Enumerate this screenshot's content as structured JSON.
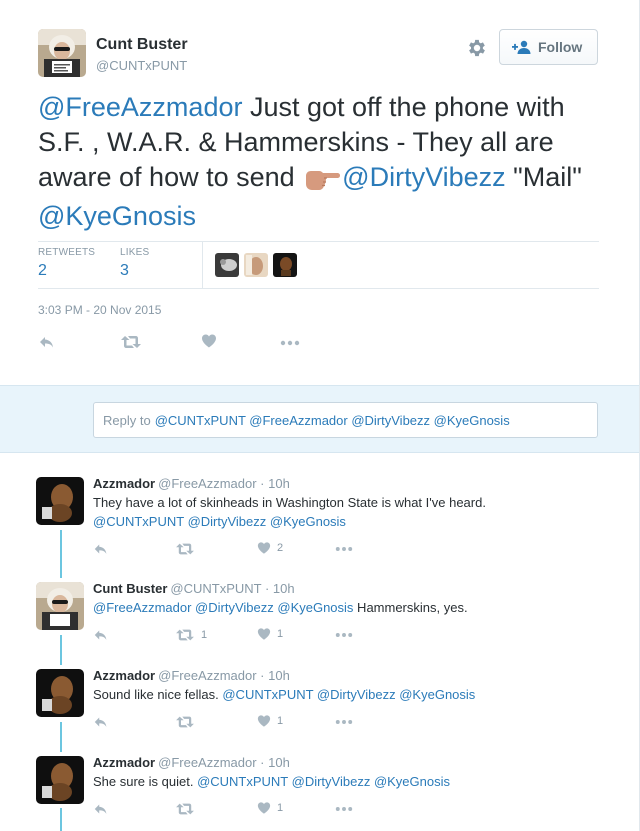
{
  "tweet": {
    "author_name": "Cunt Buster",
    "author_handle": "@CUNTxPUNT",
    "follow_label": "Follow",
    "text": {
      "m1": "@FreeAzzmador",
      "t1": " Just got off the phone with S.F. , W.A.R. & Hammerskins - They all are aware of how to send ",
      "m2": "@DirtyVibezz",
      "t2": " \"Mail\" ",
      "m3": "@KyeGnosis"
    },
    "retweets_label": "RETWEETS",
    "retweets_count": "2",
    "likes_label": "LIKES",
    "likes_count": "3",
    "timestamp": "3:03 PM - 20 Nov 2015"
  },
  "reply_box": {
    "prefix": "Reply to",
    "mentions": "@CUNTxPUNT @FreeAzzmador @DirtyVibezz @KyeGnosis"
  },
  "replies": [
    {
      "name": "Azzmador",
      "meta": "@FreeAzzmador · 10h",
      "line1": "They have a lot of skinheads in Washington State is what I've heard.",
      "mentions": "@CUNTxPUNT @DirtyVibezz @KyeGnosis",
      "retweets": "",
      "likes": "2"
    },
    {
      "name": "Cunt Buster",
      "meta": "@CUNTxPUNT · 10h",
      "mentions": "@FreeAzzmador @DirtyVibezz @KyeGnosis",
      "text_after": " Hammerskins, yes.",
      "retweets": "1",
      "likes": "1"
    },
    {
      "name": "Azzmador",
      "meta": "@FreeAzzmador · 10h",
      "text_before": "Sound like nice fellas. ",
      "mentions": "@CUNTxPUNT @DirtyVibezz @KyeGnosis",
      "retweets": "",
      "likes": "1"
    },
    {
      "name": "Azzmador",
      "meta": "@FreeAzzmador · 10h",
      "text_before": "She sure is quiet. ",
      "mentions": "@CUNTxPUNT @DirtyVibezz @KyeGnosis",
      "retweets": "",
      "likes": "1"
    }
  ],
  "icons": {
    "reply": "reply-arrow-icon",
    "retweet": "retweet-icon",
    "like": "heart-icon",
    "more": "more-dots-icon",
    "settings": "gear-icon",
    "follow": "add-person-icon",
    "emoji": "backhand-index-pointing-right-emoji"
  },
  "colors": {
    "link": "#2b7bb9",
    "muted": "#8899a6",
    "thread_line": "#6cc6e0",
    "reply_band": "#e8f4fb",
    "emoji_skin": "#d69a7e"
  }
}
